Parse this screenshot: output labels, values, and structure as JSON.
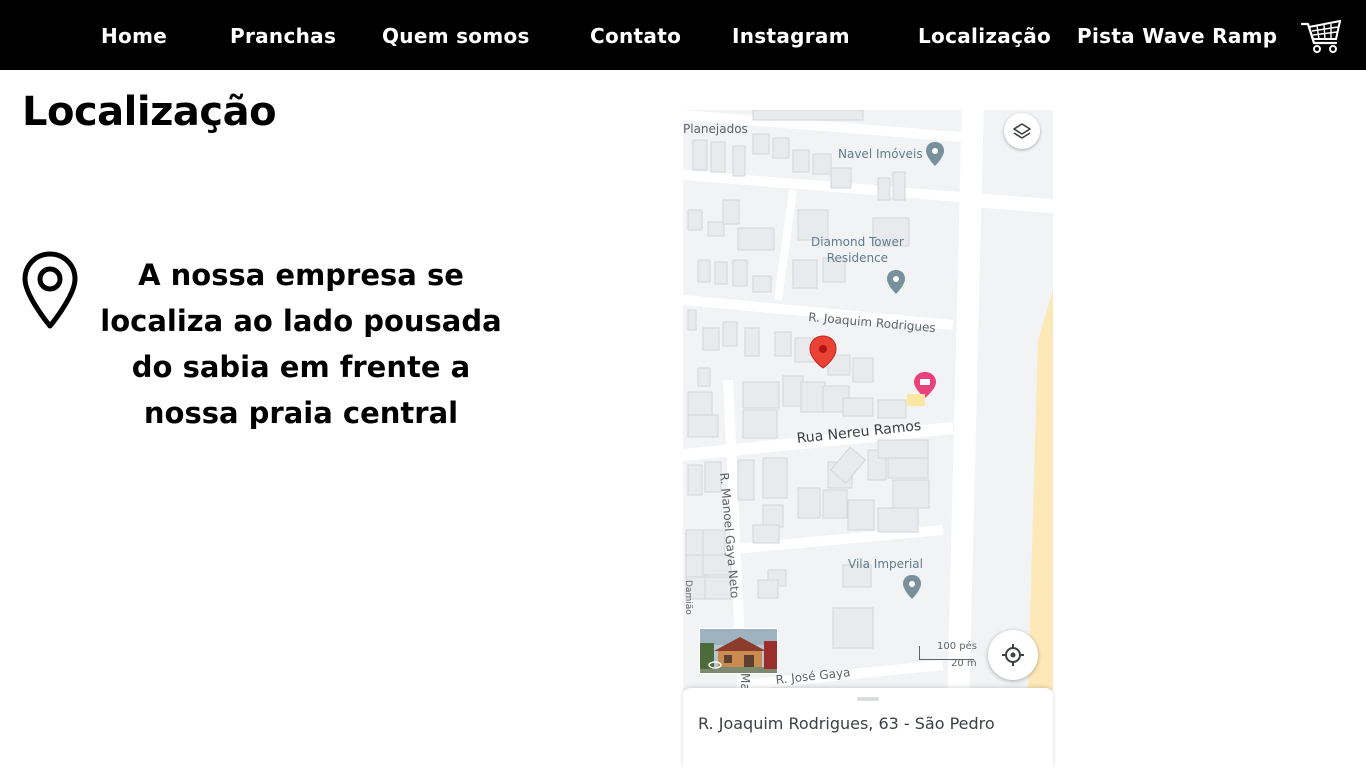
{
  "nav": {
    "items": [
      {
        "label": "Home"
      },
      {
        "label": "Pranchas"
      },
      {
        "label": "Quem somos"
      },
      {
        "label": "Contato"
      },
      {
        "label": "Instagram"
      },
      {
        "label": "Localização"
      },
      {
        "label": "Pista Wave Ramp"
      }
    ],
    "cart_icon": "shopping-cart-icon"
  },
  "page": {
    "title": "Localização",
    "pin_icon": "map-pin-icon",
    "description": "A nossa empresa se localiza ao lado pousada do sabia em frente a nossa praia central"
  },
  "map": {
    "labels": {
      "planejados": "Planejados",
      "navel": "Navel Imóveis",
      "diamond": "Diamond Tower\nResidence",
      "joaquim_street": "R. Joaquim Rodrigues",
      "nereu": "Rua Nereu Ramos",
      "manoel": "R. Manoel Gaya Neto",
      "vila": "Vila Imperial",
      "jose": "R. José Gaya",
      "ma": "Ma",
      "damiao": "Damião"
    },
    "scale": {
      "imperial": "100 pés",
      "metric": "20 m"
    },
    "address": "R. Joaquim Rodrigues, 63 - São Pedro",
    "colors": {
      "marker": "#ea4335",
      "poi": "#78909c",
      "hotel": "#ec407a",
      "beach": "#fde9b7"
    }
  }
}
